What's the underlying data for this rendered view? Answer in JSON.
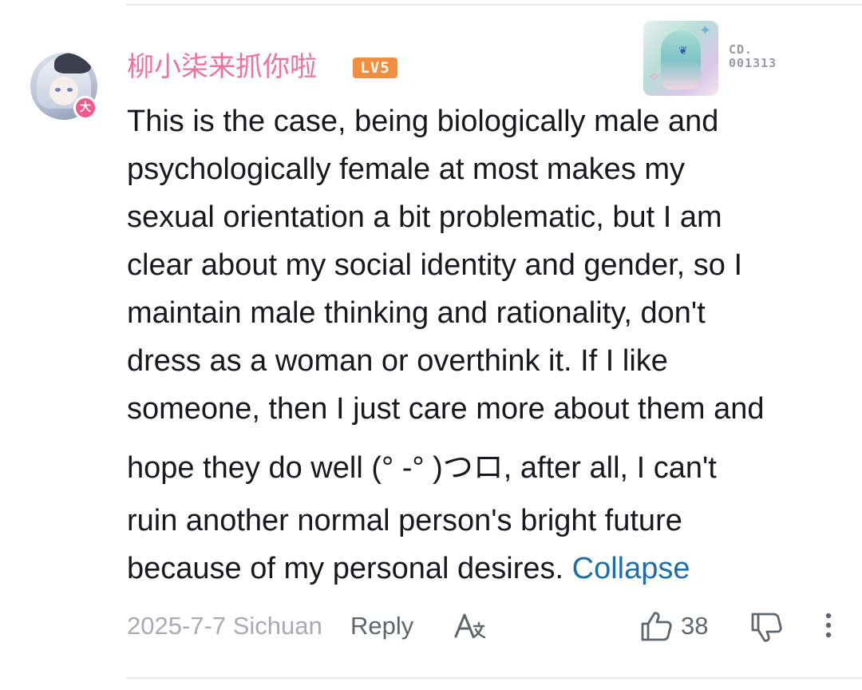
{
  "comment": {
    "username": "柳小柒来抓你啦",
    "level_badge": "LV5",
    "avatar_badge": "大",
    "decoration_card": {
      "code_prefix": "CD.",
      "code_number": "001313"
    },
    "body_lines": [
      "This is the case, being biologically male and",
      "psychologically female at most makes my",
      "sexual orientation a bit problematic, but I am",
      "clear about my social identity and gender, so I",
      "maintain male thinking and rationality, don't",
      "dress as a woman or overthink it. If I like",
      "someone, then I just care more about them and",
      "hope they do well (° -° )つロ, after all, I can't",
      "ruin another normal person's bright future",
      "because of my personal desires."
    ],
    "collapse_label": "Collapse",
    "date_location": "2025-7-7 Sichuan",
    "reply_label": "Reply",
    "like_count": "38"
  },
  "colors": {
    "username": "#f0729c",
    "level_badge": "#f28e3f",
    "link": "#1e6fa8",
    "body_text": "#18191c",
    "meta_text": "#a9abb1",
    "action_text": "#61666d"
  },
  "icons": {
    "translate": "translate-icon",
    "like": "thumbs-up-icon",
    "dislike": "thumbs-down-icon",
    "more": "more-vertical-icon"
  }
}
